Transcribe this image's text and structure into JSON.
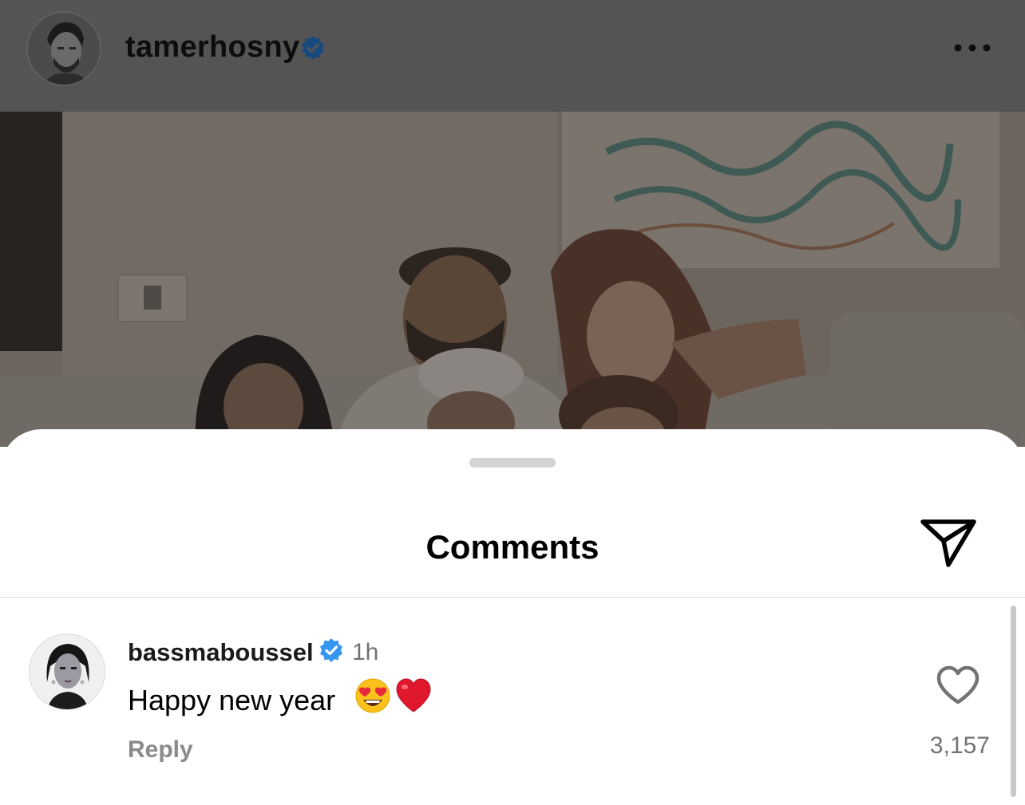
{
  "post": {
    "username": "tamerhosny",
    "verified": true,
    "menu_icon": "more-horizontal-icon"
  },
  "sheet": {
    "title": "Comments",
    "share_icon": "paper-plane-icon"
  },
  "comments": [
    {
      "username": "bassmaboussel",
      "verified": true,
      "time": "1h",
      "text": "Happy new year",
      "emojis": [
        "heart-eyes-emoji",
        "red-heart-emoji"
      ],
      "reply_label": "Reply",
      "like_count": "3,157"
    }
  ],
  "colors": {
    "verified_blue": "#3797f0",
    "dim_overlay": "#545454",
    "muted_text": "#737373"
  }
}
